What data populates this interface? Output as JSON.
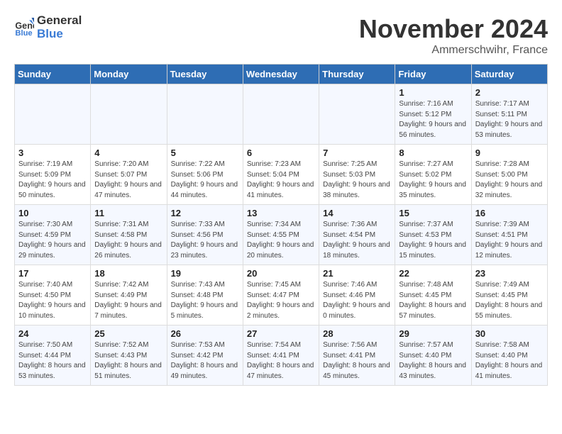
{
  "header": {
    "logo_general": "General",
    "logo_blue": "Blue",
    "month": "November 2024",
    "location": "Ammerschwihr, France"
  },
  "weekdays": [
    "Sunday",
    "Monday",
    "Tuesday",
    "Wednesday",
    "Thursday",
    "Friday",
    "Saturday"
  ],
  "weeks": [
    [
      {
        "day": "",
        "info": ""
      },
      {
        "day": "",
        "info": ""
      },
      {
        "day": "",
        "info": ""
      },
      {
        "day": "",
        "info": ""
      },
      {
        "day": "",
        "info": ""
      },
      {
        "day": "1",
        "info": "Sunrise: 7:16 AM\nSunset: 5:12 PM\nDaylight: 9 hours and 56 minutes."
      },
      {
        "day": "2",
        "info": "Sunrise: 7:17 AM\nSunset: 5:11 PM\nDaylight: 9 hours and 53 minutes."
      }
    ],
    [
      {
        "day": "3",
        "info": "Sunrise: 7:19 AM\nSunset: 5:09 PM\nDaylight: 9 hours and 50 minutes."
      },
      {
        "day": "4",
        "info": "Sunrise: 7:20 AM\nSunset: 5:07 PM\nDaylight: 9 hours and 47 minutes."
      },
      {
        "day": "5",
        "info": "Sunrise: 7:22 AM\nSunset: 5:06 PM\nDaylight: 9 hours and 44 minutes."
      },
      {
        "day": "6",
        "info": "Sunrise: 7:23 AM\nSunset: 5:04 PM\nDaylight: 9 hours and 41 minutes."
      },
      {
        "day": "7",
        "info": "Sunrise: 7:25 AM\nSunset: 5:03 PM\nDaylight: 9 hours and 38 minutes."
      },
      {
        "day": "8",
        "info": "Sunrise: 7:27 AM\nSunset: 5:02 PM\nDaylight: 9 hours and 35 minutes."
      },
      {
        "day": "9",
        "info": "Sunrise: 7:28 AM\nSunset: 5:00 PM\nDaylight: 9 hours and 32 minutes."
      }
    ],
    [
      {
        "day": "10",
        "info": "Sunrise: 7:30 AM\nSunset: 4:59 PM\nDaylight: 9 hours and 29 minutes."
      },
      {
        "day": "11",
        "info": "Sunrise: 7:31 AM\nSunset: 4:58 PM\nDaylight: 9 hours and 26 minutes."
      },
      {
        "day": "12",
        "info": "Sunrise: 7:33 AM\nSunset: 4:56 PM\nDaylight: 9 hours and 23 minutes."
      },
      {
        "day": "13",
        "info": "Sunrise: 7:34 AM\nSunset: 4:55 PM\nDaylight: 9 hours and 20 minutes."
      },
      {
        "day": "14",
        "info": "Sunrise: 7:36 AM\nSunset: 4:54 PM\nDaylight: 9 hours and 18 minutes."
      },
      {
        "day": "15",
        "info": "Sunrise: 7:37 AM\nSunset: 4:53 PM\nDaylight: 9 hours and 15 minutes."
      },
      {
        "day": "16",
        "info": "Sunrise: 7:39 AM\nSunset: 4:51 PM\nDaylight: 9 hours and 12 minutes."
      }
    ],
    [
      {
        "day": "17",
        "info": "Sunrise: 7:40 AM\nSunset: 4:50 PM\nDaylight: 9 hours and 10 minutes."
      },
      {
        "day": "18",
        "info": "Sunrise: 7:42 AM\nSunset: 4:49 PM\nDaylight: 9 hours and 7 minutes."
      },
      {
        "day": "19",
        "info": "Sunrise: 7:43 AM\nSunset: 4:48 PM\nDaylight: 9 hours and 5 minutes."
      },
      {
        "day": "20",
        "info": "Sunrise: 7:45 AM\nSunset: 4:47 PM\nDaylight: 9 hours and 2 minutes."
      },
      {
        "day": "21",
        "info": "Sunrise: 7:46 AM\nSunset: 4:46 PM\nDaylight: 9 hours and 0 minutes."
      },
      {
        "day": "22",
        "info": "Sunrise: 7:48 AM\nSunset: 4:45 PM\nDaylight: 8 hours and 57 minutes."
      },
      {
        "day": "23",
        "info": "Sunrise: 7:49 AM\nSunset: 4:45 PM\nDaylight: 8 hours and 55 minutes."
      }
    ],
    [
      {
        "day": "24",
        "info": "Sunrise: 7:50 AM\nSunset: 4:44 PM\nDaylight: 8 hours and 53 minutes."
      },
      {
        "day": "25",
        "info": "Sunrise: 7:52 AM\nSunset: 4:43 PM\nDaylight: 8 hours and 51 minutes."
      },
      {
        "day": "26",
        "info": "Sunrise: 7:53 AM\nSunset: 4:42 PM\nDaylight: 8 hours and 49 minutes."
      },
      {
        "day": "27",
        "info": "Sunrise: 7:54 AM\nSunset: 4:41 PM\nDaylight: 8 hours and 47 minutes."
      },
      {
        "day": "28",
        "info": "Sunrise: 7:56 AM\nSunset: 4:41 PM\nDaylight: 8 hours and 45 minutes."
      },
      {
        "day": "29",
        "info": "Sunrise: 7:57 AM\nSunset: 4:40 PM\nDaylight: 8 hours and 43 minutes."
      },
      {
        "day": "30",
        "info": "Sunrise: 7:58 AM\nSunset: 4:40 PM\nDaylight: 8 hours and 41 minutes."
      }
    ]
  ]
}
